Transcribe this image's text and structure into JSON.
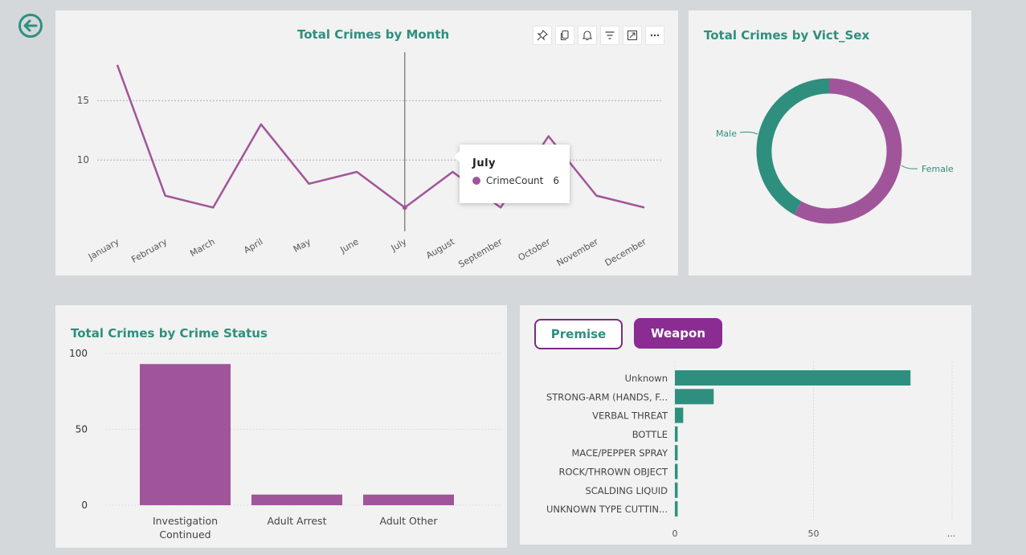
{
  "colors": {
    "accent_teal": "#2f8f7f",
    "accent_purple": "#a0559a",
    "button_purple": "#8a2c92",
    "panel_bg": "#f1f2f1",
    "page_bg": "#d4d8db"
  },
  "nav": {
    "back_icon": "back-arrow-icon"
  },
  "month_chart": {
    "title": "Total Crimes by Month",
    "toolbar_icons": [
      "pin-icon",
      "copy-icon",
      "bell-icon",
      "filter-icon",
      "focus-mode-icon",
      "more-options-icon"
    ],
    "tooltip": {
      "month": "July",
      "series": "CrimeCount",
      "value": "6"
    }
  },
  "vict_chart": {
    "title": "Total Crimes by Vict_Sex",
    "labels": {
      "male": "Male",
      "female": "Female"
    }
  },
  "status_chart": {
    "title": "Total Crimes by Crime Status"
  },
  "weapon_panel": {
    "premise_label": "Premise",
    "weapon_label": "Weapon",
    "axis_more": "..."
  },
  "chart_data": [
    {
      "type": "line",
      "title": "Total Crimes by Month",
      "categories": [
        "January",
        "February",
        "March",
        "April",
        "May",
        "June",
        "July",
        "August",
        "September",
        "October",
        "November",
        "December"
      ],
      "series": [
        {
          "name": "CrimeCount",
          "values": [
            18,
            7,
            6,
            13,
            8,
            9,
            6,
            9,
            6,
            12,
            7,
            6
          ]
        }
      ],
      "yticks": [
        10,
        15
      ],
      "ylim": [
        4,
        19
      ],
      "grid": true
    },
    {
      "type": "pie",
      "title": "Total Crimes by Vict_Sex",
      "categories": [
        "Female",
        "Male"
      ],
      "values": [
        58,
        42
      ],
      "colors": [
        "#a0559a",
        "#2f8f7f"
      ]
    },
    {
      "type": "bar",
      "title": "Total Crimes by Crime Status",
      "categories": [
        [
          "Investigation",
          "Continued"
        ],
        [
          "Adult Arrest"
        ],
        [
          "Adult Other"
        ]
      ],
      "values": [
        93,
        7,
        7
      ],
      "yticks": [
        0,
        50,
        100
      ],
      "ylim": [
        0,
        100
      ]
    },
    {
      "type": "bar",
      "orientation": "horizontal",
      "categories": [
        "Unknown",
        "STRONG-ARM (HANDS, F...",
        "VERBAL THREAT",
        "BOTTLE",
        "MACE/PEPPER SPRAY",
        "ROCK/THROWN OBJECT",
        "SCALDING LIQUID",
        "UNKNOWN TYPE CUTTIN..."
      ],
      "values": [
        85,
        14,
        3,
        1,
        1,
        1,
        1,
        1
      ],
      "xticks": [
        0,
        50
      ],
      "xlim": [
        0,
        100
      ]
    }
  ]
}
